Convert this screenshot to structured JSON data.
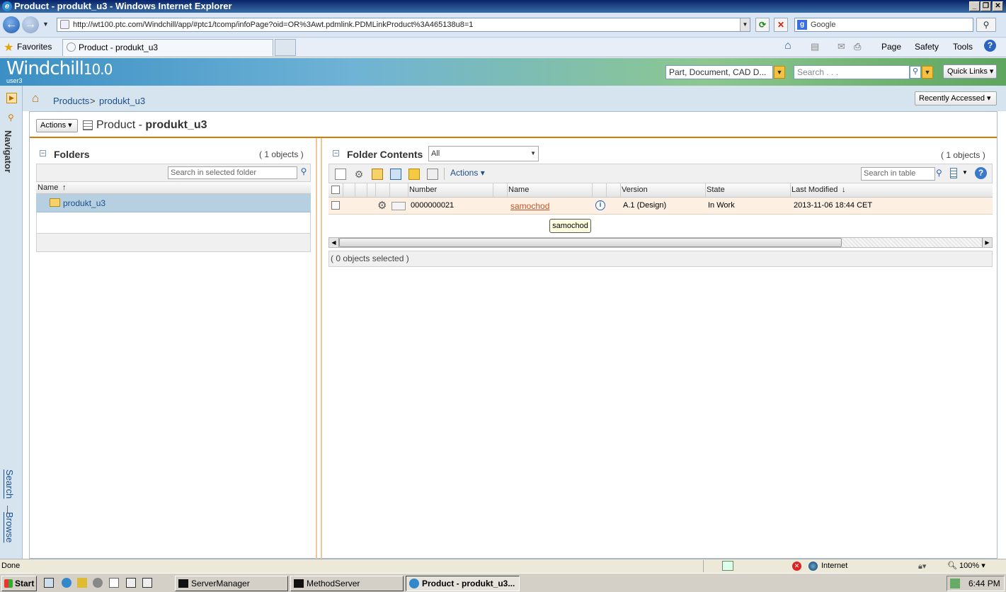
{
  "window": {
    "title": "Product - produkt_u3 - Windows Internet Explorer"
  },
  "browser": {
    "url": "http://wt100.ptc.com/Windchill/app/#ptc1/tcomp/infoPage?oid=OR%3Awt.pdmlink.PDMLinkProduct%3A465138u8=1",
    "search_placeholder": "Google",
    "favorites_label": "Favorites",
    "tab_title": "Product - produkt_u3",
    "commands": [
      "Page",
      "Safety",
      "Tools"
    ]
  },
  "app": {
    "logo": "Windchill",
    "version": "10.0",
    "user": "user3",
    "search_type": "Part, Document, CAD D...",
    "search_placeholder": "Search . . .",
    "quick_links": "Quick Links",
    "recently_accessed": "Recently Accessed"
  },
  "breadcrumb": {
    "items": [
      "Products",
      "produkt_u3"
    ],
    "separator": ">"
  },
  "leftnav": {
    "navigator": "Navigator",
    "search": "Search",
    "browse": "Browse",
    "divider": "|"
  },
  "page": {
    "actions": "Actions",
    "type": "Product",
    "separator": "-",
    "name": "produkt_u3"
  },
  "folders": {
    "title": "Folders",
    "count": "( 1 objects )",
    "search_placeholder": "Search in selected folder",
    "col_name": "Name",
    "items": [
      {
        "label": "produkt_u3"
      }
    ]
  },
  "contents": {
    "title": "Folder Contents",
    "view": "All",
    "count": "( 1 objects )",
    "actions": "Actions",
    "search_placeholder": "Search in table",
    "columns": [
      "Number",
      "Name",
      "Version",
      "State",
      "Last Modified"
    ],
    "rows": [
      {
        "number": "0000000021",
        "name": "samochod",
        "version": "A.1 (Design)",
        "state": "In Work",
        "modified": "2013-11-06 18:44 CET"
      }
    ],
    "tooltip": "samochod",
    "selected": "( 0 objects selected )"
  },
  "status": {
    "text": "Done",
    "zone": "Internet",
    "zoom": "100%"
  },
  "taskbar": {
    "start": "Start",
    "buttons": [
      "ServerManager",
      "MethodServer",
      "Product - produkt_u3..."
    ],
    "clock": "6:44 PM"
  },
  "colors": {
    "accent": "#d67a00",
    "link": "#1c4f8c",
    "selected_row": "#b6cfe1",
    "row_hover": "#fdf0e3"
  }
}
